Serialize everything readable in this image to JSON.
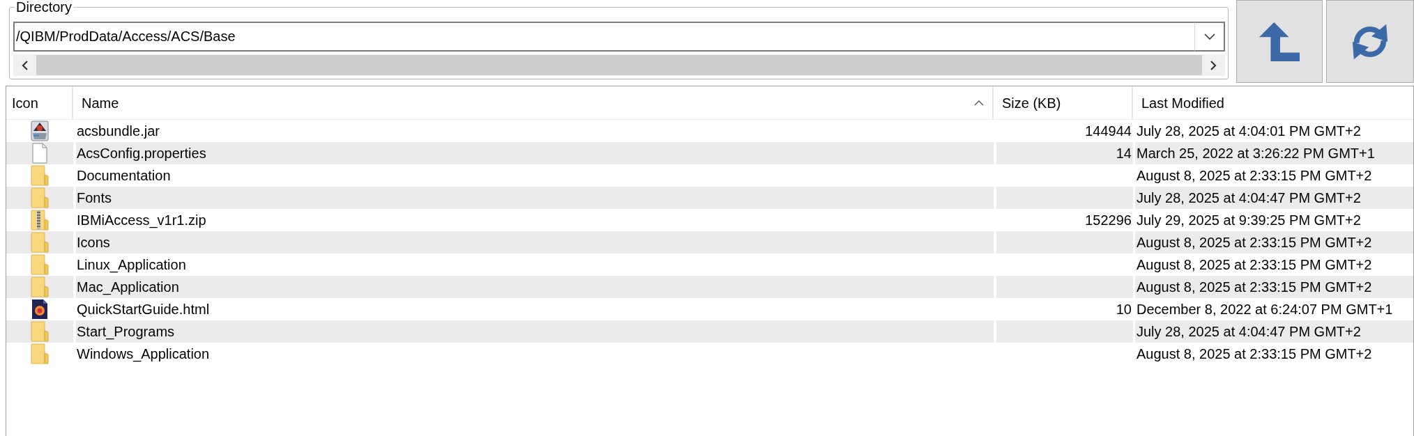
{
  "directory": {
    "label": "Directory",
    "value": "/QIBM/ProdData/Access/ACS/Base"
  },
  "table": {
    "columns": [
      {
        "label": "Icon",
        "sorted": false
      },
      {
        "label": "Name",
        "sorted": true
      },
      {
        "label": "Size (KB)",
        "sorted": false
      },
      {
        "label": "Last Modified",
        "sorted": false
      }
    ],
    "rows": [
      {
        "kind": "jar",
        "name": "acsbundle.jar",
        "size": "144944",
        "modified": "July 28, 2025 at 4:04:01 PM GMT+2",
        "selected": false
      },
      {
        "kind": "file",
        "name": "AcsConfig.properties",
        "size": "14",
        "modified": "March 25, 2022 at 3:26:22 PM GMT+1",
        "selected": false
      },
      {
        "kind": "folder",
        "name": "Documentation",
        "modified": "August 8, 2025 at 2:33:15 PM GMT+2",
        "selected": false
      },
      {
        "kind": "folder",
        "name": "Fonts",
        "modified": "July 28, 2025 at 4:04:47 PM GMT+2",
        "selected": false
      },
      {
        "kind": "zip",
        "name": "IBMiAccess_v1r1.zip",
        "size": "152296",
        "modified": "July 29, 2025 at 9:39:25 PM GMT+2",
        "selected": false
      },
      {
        "kind": "folder",
        "name": "Icons",
        "modified": "August 8, 2025 at 2:33:15 PM GMT+2",
        "selected": false
      },
      {
        "kind": "folder",
        "name": "Linux_Application",
        "modified": "August 8, 2025 at 2:33:15 PM GMT+2",
        "selected": false
      },
      {
        "kind": "folder",
        "name": "Mac_Application",
        "modified": "August 8, 2025 at 2:33:15 PM GMT+2",
        "selected": false
      },
      {
        "kind": "html",
        "name": "QuickStartGuide.html",
        "size": "10",
        "modified": "December 8, 2022 at 6:24:07 PM GMT+1",
        "selected": false
      },
      {
        "kind": "folder",
        "name": "Start_Programs",
        "modified": "July 28, 2025 at 4:04:47 PM GMT+2",
        "selected": false
      },
      {
        "kind": "folder",
        "name": "Windows_Application",
        "modified": "August 8, 2025 at 2:33:15 PM GMT+2",
        "selected": false
      }
    ]
  }
}
